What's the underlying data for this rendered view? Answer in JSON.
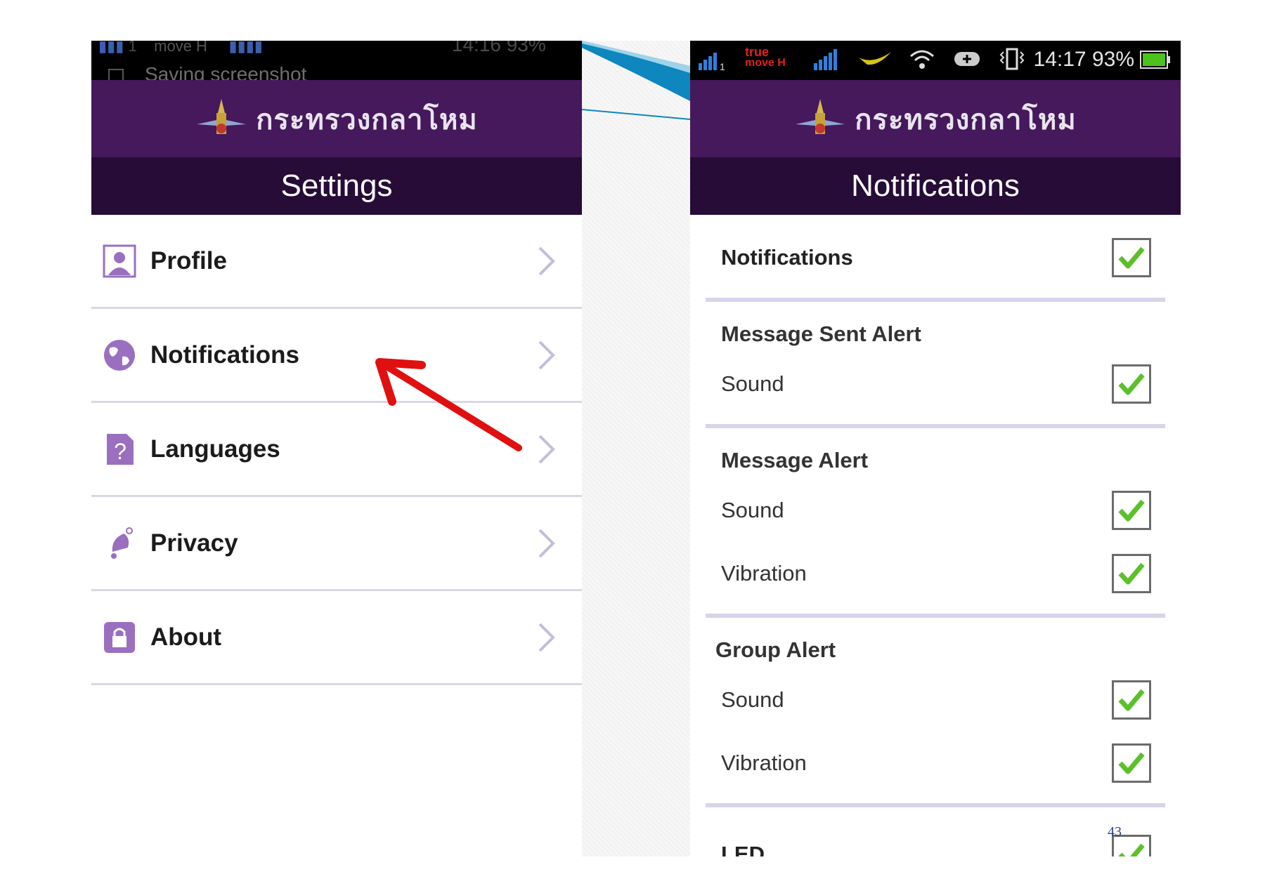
{
  "left_screen": {
    "status_bar": {
      "carrier": "move H",
      "time_partial": "14:16 93%",
      "notification": "Saving screenshot"
    },
    "brand_title": "กระทรวงกลาโหม",
    "screen_title": "Settings",
    "menu_items": [
      {
        "label": "Profile",
        "icon": "profile-icon"
      },
      {
        "label": "Notifications",
        "icon": "globe-icon"
      },
      {
        "label": "Languages",
        "icon": "question-doc-icon"
      },
      {
        "label": "Privacy",
        "icon": "bell-icon"
      },
      {
        "label": "About",
        "icon": "lock-icon"
      }
    ]
  },
  "right_screen": {
    "status_bar": {
      "carrier_top": "true",
      "carrier_bottom": "move H",
      "time": "14:17",
      "battery": "93%"
    },
    "brand_title": "กระทรวงกลาโหม",
    "screen_title": "Notifications",
    "notifications_toggle": {
      "label": "Notifications",
      "checked": true
    },
    "sections": [
      {
        "title": "Message Sent Alert",
        "rows": [
          {
            "label": "Sound",
            "checked": true
          }
        ]
      },
      {
        "title": "Message Alert",
        "rows": [
          {
            "label": "Sound",
            "checked": true
          },
          {
            "label": "Vibration",
            "checked": true
          }
        ]
      },
      {
        "title": "Group Alert",
        "rows": [
          {
            "label": "Sound",
            "checked": true
          },
          {
            "label": "Vibration",
            "checked": true
          }
        ]
      }
    ],
    "led_row": {
      "label": "LED",
      "checked": true
    }
  },
  "page_number": "43",
  "colors": {
    "brand_purple": "#45195c",
    "title_dark": "#260c36",
    "divider": "#d8d4ea",
    "icon_purple": "#9a6fbf",
    "check_green": "#5cc02a",
    "arrow_red": "#e01010"
  }
}
